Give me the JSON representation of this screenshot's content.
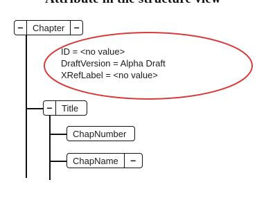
{
  "header": {
    "title": "Attribute in the structure view"
  },
  "tree": {
    "root": {
      "label": "Chapter",
      "toggle_left": "−",
      "toggle_right": "−"
    },
    "attributes": [
      {
        "name": "ID",
        "value": "<no value>"
      },
      {
        "name": "DraftVersion",
        "value": "Alpha Draft"
      },
      {
        "name": "XRefLabel",
        "value": "<no value>"
      }
    ],
    "title_node": {
      "label": "Title",
      "toggle_left": "−"
    },
    "chapnumber_node": {
      "label": "ChapNumber"
    },
    "chapname_node": {
      "label": "ChapName",
      "toggle_right": "−"
    }
  },
  "colors": {
    "highlight_ellipse": "#d83a3a",
    "lines": "#111111"
  }
}
